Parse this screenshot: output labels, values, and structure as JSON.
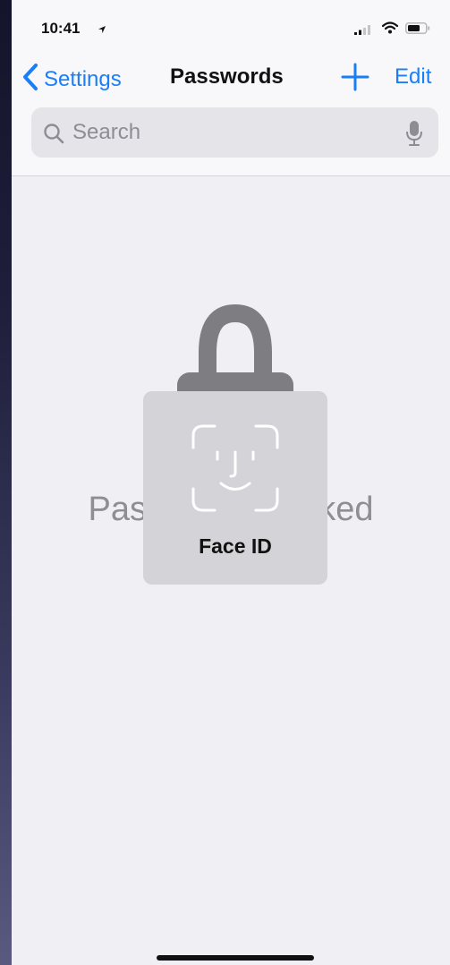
{
  "status_bar": {
    "time": "10:41",
    "location_icon": "location-arrow-icon",
    "signal_icon": "cellular-signal-icon",
    "wifi_icon": "wifi-icon",
    "battery_icon": "battery-icon"
  },
  "nav": {
    "back_label": "Settings",
    "title": "Passwords",
    "add_icon": "plus-icon",
    "edit_label": "Edit"
  },
  "search": {
    "placeholder": "Search",
    "value": "",
    "search_icon": "magnifier-icon",
    "mic_icon": "microphone-icon"
  },
  "locked": {
    "message": "Passwords Locked",
    "lock_icon": "lock-icon"
  },
  "face_id": {
    "label": "Face ID",
    "glyph_icon": "face-id-icon"
  },
  "colors": {
    "accent": "#1a7ef6",
    "background": "#efeff4",
    "secondary_text": "#8e8e93",
    "lock_gray": "#7d7d82",
    "hud_background": "#d4d4d8"
  }
}
